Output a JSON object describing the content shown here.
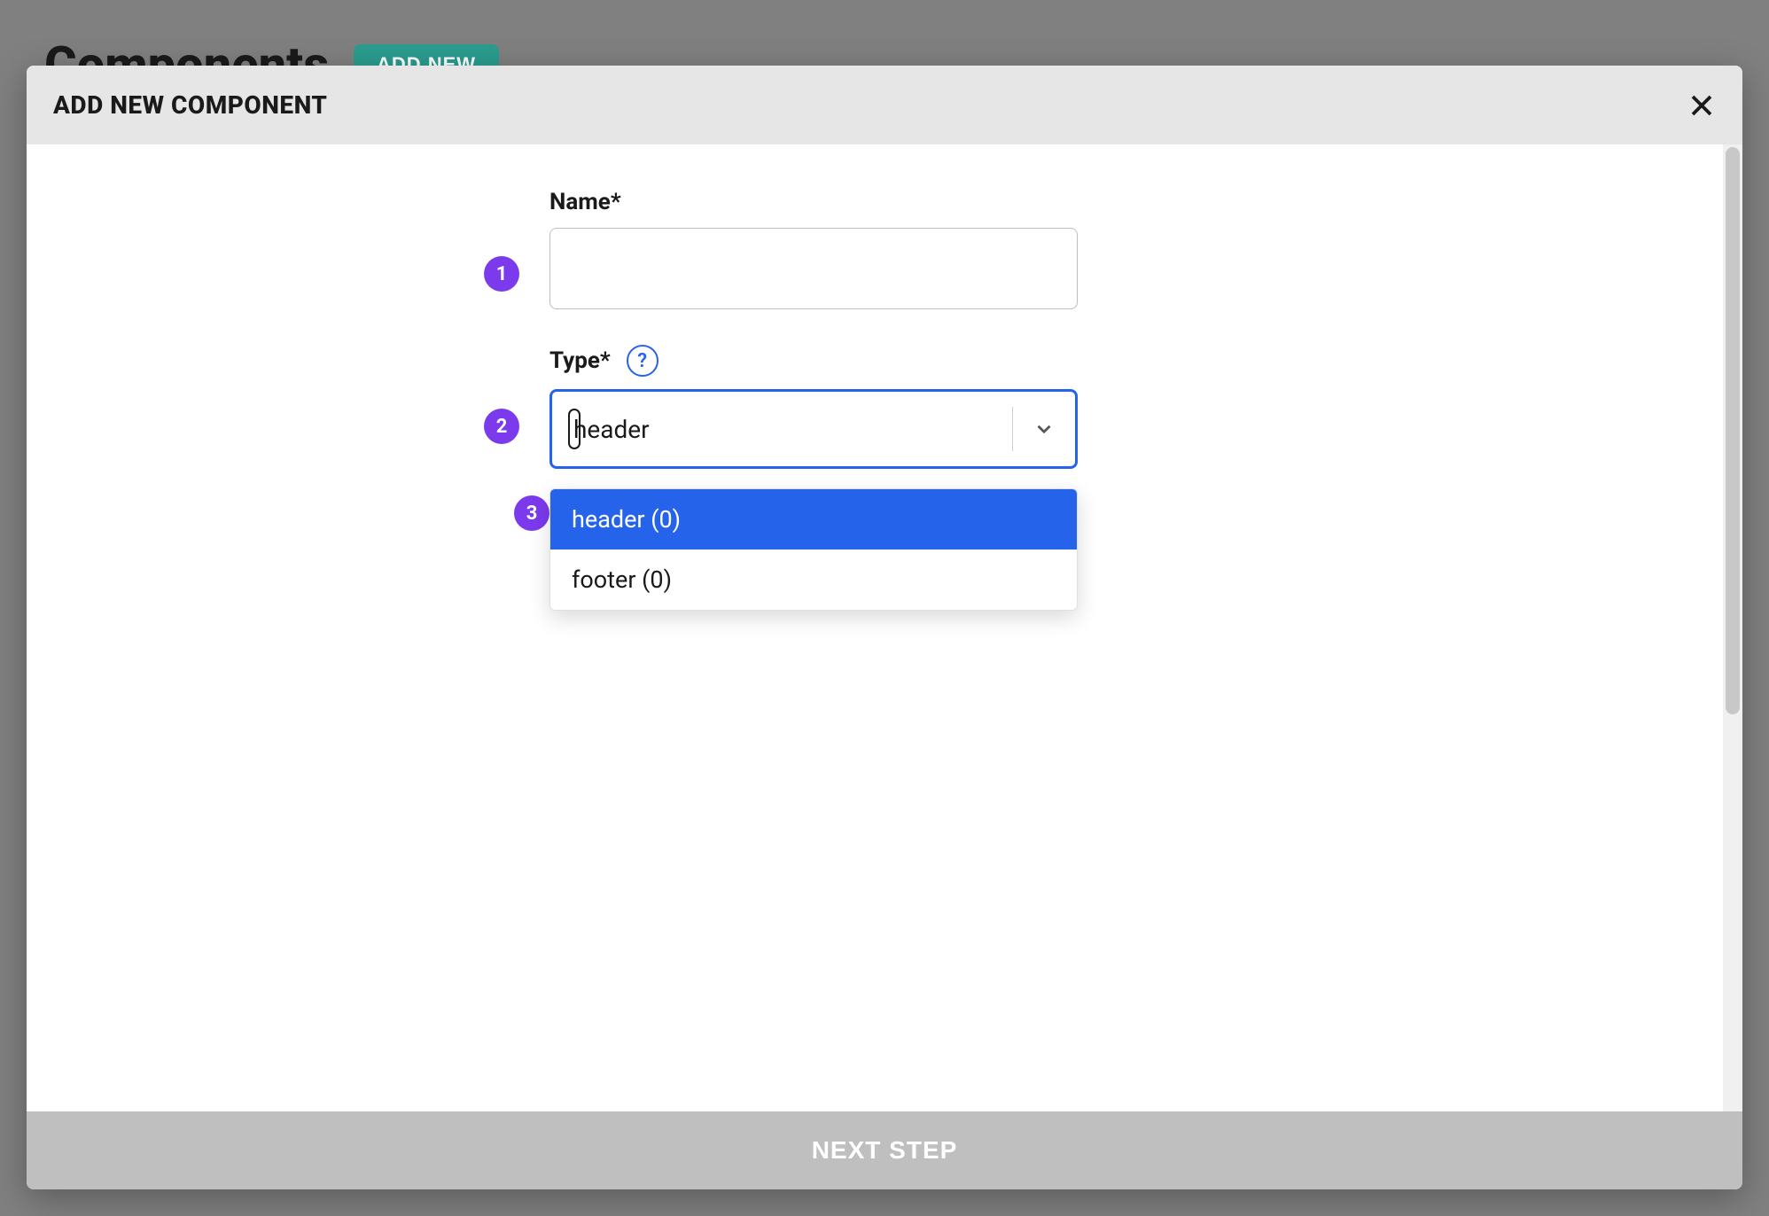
{
  "background": {
    "page_title": "Components",
    "add_new_label": "ADD NEW"
  },
  "modal": {
    "title": "ADD NEW COMPONENT",
    "footer_button": "NEXT STEP"
  },
  "form": {
    "name": {
      "label": "Name*",
      "value": ""
    },
    "type": {
      "label": "Type*",
      "value": "header",
      "options": [
        {
          "label": "header (0)",
          "highlighted": true
        },
        {
          "label": "footer (0)",
          "highlighted": false
        }
      ]
    }
  },
  "step_badges": [
    "1",
    "2",
    "3"
  ]
}
